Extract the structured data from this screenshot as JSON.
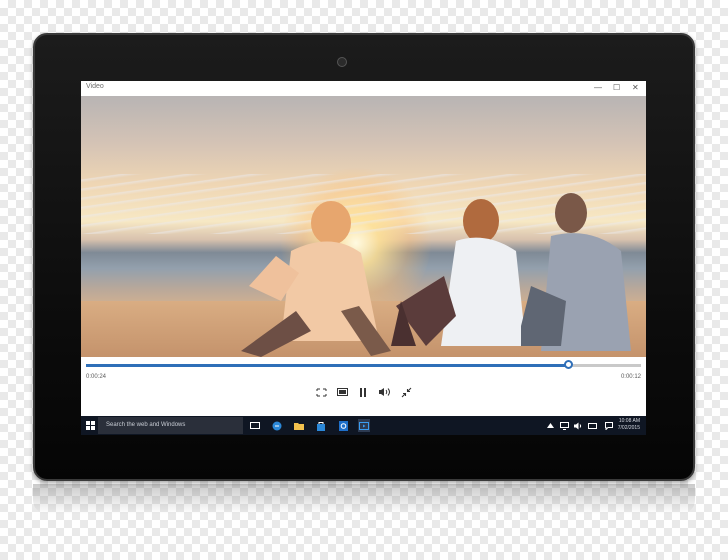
{
  "app": {
    "title": "Video"
  },
  "window_controls": {
    "minimize": "—",
    "maximize": "☐",
    "close": "✕"
  },
  "player": {
    "progress_fraction": 0.87,
    "elapsed": "0:00:24",
    "duration": "0:00:12",
    "controls": [
      "aspect-ratio",
      "mini-view",
      "pause",
      "volume",
      "exit-fullscreen"
    ]
  },
  "taskbar": {
    "search_placeholder": "Search the web and Windows",
    "apps": [
      "task-view",
      "edge",
      "file-explorer",
      "store",
      "outlook",
      "video"
    ],
    "clock": {
      "time": "10:08 AM",
      "date": "7/02/2015"
    }
  },
  "colors": {
    "accent": "#2f6fb8",
    "taskbar": "#0f1623",
    "bezel": "#0d0d0d"
  }
}
